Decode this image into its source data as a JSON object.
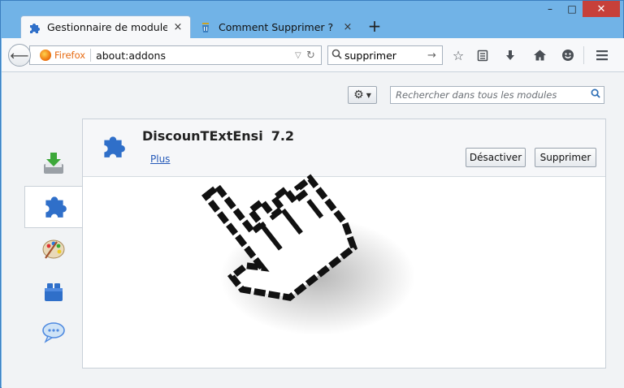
{
  "tabs": [
    {
      "title": "Gestionnaire de modules c...",
      "close": "×",
      "icon": "puzzle-icon"
    },
    {
      "title": "Comment Supprimer ? Net...",
      "close": "×",
      "icon": "bin-icon"
    }
  ],
  "new_tab": "+",
  "window_controls": {
    "minimize": "–",
    "maximize": "□",
    "close": "✕"
  },
  "navbar": {
    "identity_label": "Firefox",
    "url": "about:addons",
    "search_value": "supprimer"
  },
  "addons_manager": {
    "search_placeholder": "Rechercher dans tous les modules",
    "sidebar_icons": [
      "get-addons-icon",
      "extensions-icon",
      "appearance-icon",
      "plugins-icon",
      "services-icon"
    ],
    "addon": {
      "name": "DiscounTExtEnsi",
      "version": "7.2",
      "more_link": "Plus",
      "disable_label": "Désactiver",
      "remove_label": "Supprimer"
    }
  },
  "colors": {
    "titlebar": "#71b3e7",
    "close_button": "#c7403a",
    "link": "#2459b8",
    "puzzle_blue": "#2f6fc9"
  }
}
